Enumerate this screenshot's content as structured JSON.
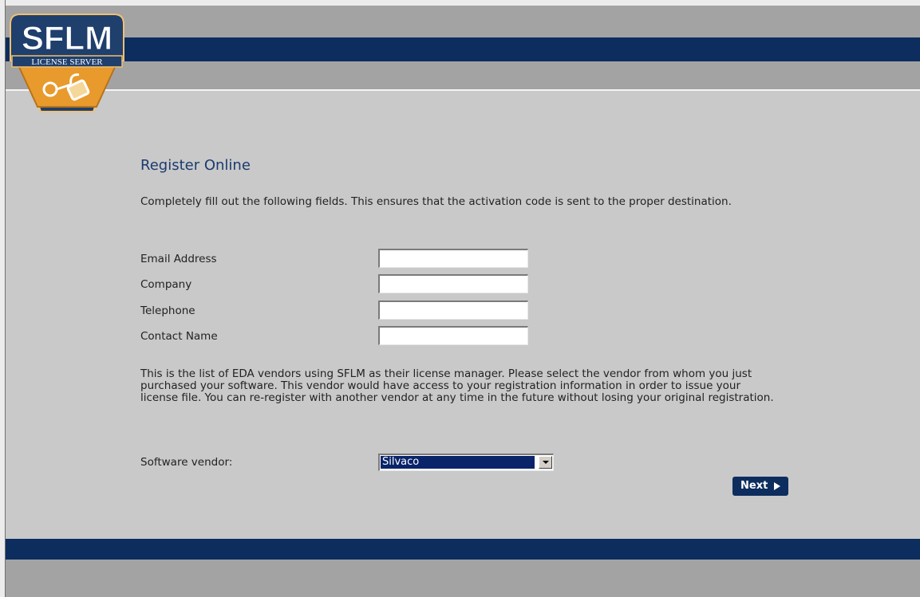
{
  "brand": {
    "logo_text": "SFLM",
    "logo_subtext": "LICENSE SERVER"
  },
  "page": {
    "title": "Register Online",
    "intro": "Completely fill out the following fields. This ensures that the activation code is sent to the proper destination."
  },
  "form": {
    "fields": [
      {
        "label": "Email Address",
        "value": ""
      },
      {
        "label": "Company",
        "value": ""
      },
      {
        "label": "Telephone",
        "value": ""
      },
      {
        "label": "Contact Name",
        "value": ""
      }
    ],
    "vendor_text": "This is the list of EDA vendors using SFLM as their license manager. Please select the vendor from whom you just purchased your software. This vendor would have access to your registration information in order to issue your license file. You can re-register with another vendor at any time in the future without losing your original registration.",
    "vendor_label": "Software vendor:",
    "vendor_selected": "Silvaco",
    "next_label": "Next"
  },
  "colors": {
    "navy": "#0d2d5e",
    "header_gray": "#a3a3a3",
    "background": "#c9c9c9",
    "title_blue": "#1b3b6f",
    "logo_orange": "#e89a2c"
  },
  "icons": {
    "logo": "sflm-logo-icon",
    "next_arrow": "triangle-right-icon",
    "dropdown_arrow": "chevron-down-icon"
  }
}
